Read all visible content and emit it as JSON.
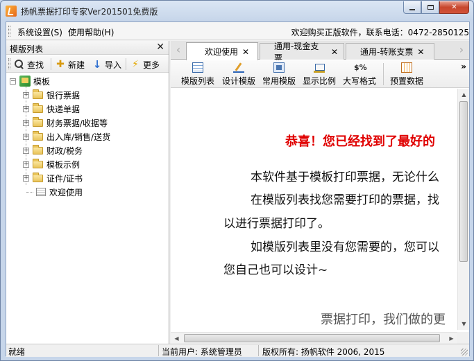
{
  "window": {
    "title": "扬帆票据打印专家Ver201501免费版",
    "icons": {
      "app": "app-logo-icon",
      "minimize": "minimize-icon",
      "maximize": "maximize-icon",
      "close": "close-icon"
    },
    "close_glyph": "✕"
  },
  "menubar": {
    "items": [
      {
        "label": "系统设置(S)"
      },
      {
        "label": "使用帮助(H)"
      }
    ],
    "promo": "欢迎购买正版软件，联系电话：0472-2850125"
  },
  "left_panel": {
    "title": "模版列表",
    "close_glyph": "✕",
    "toolbar": [
      {
        "label": "查找",
        "icon": "search-icon"
      },
      {
        "label": "新建",
        "icon": "new-icon",
        "glyph": "✚"
      },
      {
        "label": "导入",
        "icon": "import-icon",
        "glyph": "↓"
      },
      {
        "label": "更多",
        "icon": "more-icon",
        "glyph": "⚡"
      }
    ],
    "tree": {
      "expander_collapse": "−",
      "expander_expand": "+",
      "root": "模板",
      "children": [
        {
          "label": "银行票据",
          "type": "folder"
        },
        {
          "label": "快递单据",
          "type": "folder"
        },
        {
          "label": "财务票据/收据等",
          "type": "folder"
        },
        {
          "label": "出入库/销售/送货",
          "type": "folder"
        },
        {
          "label": "财政/税务",
          "type": "folder"
        },
        {
          "label": "模板示例",
          "type": "folder"
        },
        {
          "label": "证件/证书",
          "type": "folder"
        },
        {
          "label": "欢迎使用",
          "type": "document"
        }
      ]
    }
  },
  "tabs": {
    "left_arrow": "‹",
    "right_arrow": "›",
    "close_glyph": "✕",
    "items": [
      {
        "label": "欢迎使用",
        "active": true
      },
      {
        "label": "通用-现金支票",
        "active": false
      },
      {
        "label": "通用-转账支票",
        "active": false
      }
    ]
  },
  "toolbar": {
    "overflow": "»",
    "buttons": [
      {
        "label": "模版列表",
        "icon": "template-list-icon"
      },
      {
        "label": "设计模版",
        "icon": "design-template-icon"
      },
      {
        "label": "常用模版",
        "icon": "common-template-icon"
      },
      {
        "label": "显示比例",
        "icon": "zoom-ratio-icon"
      },
      {
        "label": "大写格式",
        "icon": "uppercase-format-icon",
        "glyph": "$%"
      },
      {
        "label": "预置数据",
        "icon": "preset-data-icon"
      }
    ]
  },
  "content": {
    "title": "恭喜！您已经找到了最好的",
    "lines": [
      "本软件基于模板打印票据，无论什么",
      "在模版列表找您需要打印的票据，找",
      "以进行票据打印了。",
      "如模版列表里没有您需要的，您可以",
      "您自己也可以设计~"
    ],
    "footer": "票据打印，我们做的更"
  },
  "scrollbars": {
    "up": "▲",
    "down": "▼",
    "left": "◀",
    "right": "▶"
  },
  "statusbar": {
    "status": "就绪",
    "user": "当前用户: 系统管理员",
    "copyright": "版权所有: 扬帆软件 2006, 2015"
  },
  "colors": {
    "title_red": "#e00000",
    "frame": "#c7d6ea"
  }
}
